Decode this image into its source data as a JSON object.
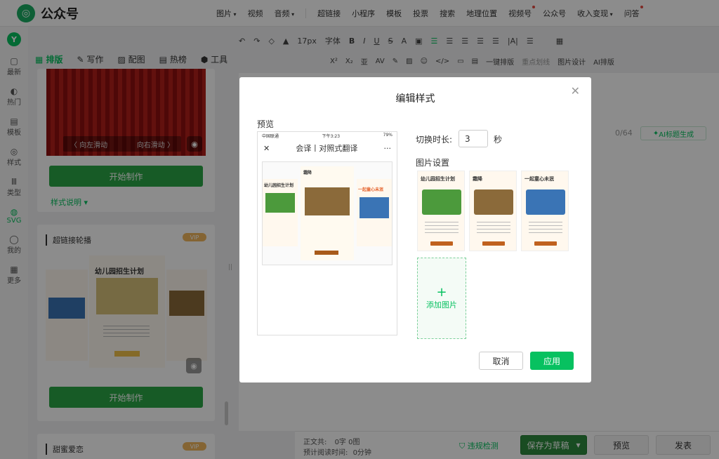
{
  "app": {
    "brand": "公众号"
  },
  "topnav": {
    "items": [
      {
        "label": "图片",
        "caret": true
      },
      {
        "label": "视频"
      },
      {
        "label": "音频",
        "caret": true
      }
    ],
    "items2": [
      {
        "label": "超链接"
      },
      {
        "label": "小程序"
      },
      {
        "label": "模板"
      },
      {
        "label": "投票"
      },
      {
        "label": "搜索"
      },
      {
        "label": "地理位置"
      },
      {
        "label": "视频号",
        "dot": true
      },
      {
        "label": "公众号"
      },
      {
        "label": "收入变现",
        "caret": true
      },
      {
        "label": "问答",
        "dot": true
      }
    ]
  },
  "toolbar1": {
    "font_size": "17px",
    "font_family": "字体",
    "items": [
      "B",
      "I",
      "U",
      "S",
      "A"
    ]
  },
  "toolbar2": {
    "items": [
      "X²",
      "X₂",
      "亚",
      "AV",
      "一键排版",
      "重点划线",
      "图片设计",
      "AI排版"
    ]
  },
  "rail": {
    "top_logo": "Y",
    "items": [
      {
        "icon": "▢",
        "label": "最新"
      },
      {
        "icon": "◐",
        "label": "热门"
      },
      {
        "icon": "▤",
        "label": "模板"
      },
      {
        "icon": "◎",
        "label": "样式"
      },
      {
        "icon": "Ⅲ",
        "label": "类型"
      },
      {
        "icon": "◍",
        "label": "SVG",
        "active": true
      },
      {
        "icon": "◯",
        "label": "我的"
      },
      {
        "icon": "▦",
        "label": "更多"
      }
    ]
  },
  "left_tabs": [
    {
      "label": "排版",
      "active": true
    },
    {
      "label": "写作"
    },
    {
      "label": "配图"
    },
    {
      "label": "热榜"
    },
    {
      "label": "工具"
    }
  ],
  "card1": {
    "swipe_left": "〈 向左滑动",
    "swipe_right": "向右滑动 〉",
    "start_button": "开始制作",
    "style_note": "样式说明 ▾"
  },
  "card2": {
    "title": "超链接轮播",
    "vip": "VIP",
    "poster_title": "幼儿园招生计划",
    "start_button": "开始制作"
  },
  "card3": {
    "title": "甜蜜爱恋",
    "vip": "VIP"
  },
  "editor": {
    "count": "0/64",
    "ai_title": "AI标题生成"
  },
  "bottombar": {
    "body_label": "正文共:",
    "body_value": "0字 0图",
    "read_label": "预计阅读时间:",
    "read_value": "0分钟",
    "check": "违规检测",
    "save_draft": "保存为草稿",
    "preview": "预览",
    "publish": "发表"
  },
  "modal": {
    "title": "编辑样式",
    "preview_label": "预览",
    "phone_carrier": "中国联通",
    "phone_time": "下午3:23",
    "phone_battery": "79%",
    "phone_title": "会译丨对照式翻译",
    "switch_label": "切换时长:",
    "switch_value": "3",
    "switch_unit": "秒",
    "images_label": "图片设置",
    "add_image": "添加图片",
    "cancel": "取消",
    "apply": "应用",
    "thumbs": [
      {
        "head": "幼儿园招生计划",
        "color": "#4c9a3c"
      },
      {
        "head": "霜降",
        "color": "#8b6a3a"
      },
      {
        "head": "一起童心未泯",
        "color": "#3a74b5"
      }
    ]
  },
  "colors": {
    "brand_green": "#07c160",
    "button_green": "#2aa745",
    "curtain_red": "#a3161a"
  }
}
